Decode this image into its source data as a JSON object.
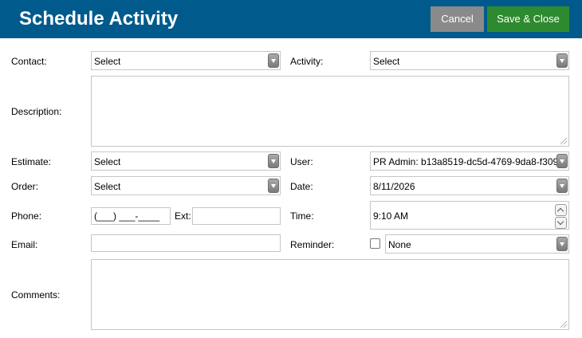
{
  "header": {
    "title": "Schedule Activity",
    "cancel_label": "Cancel",
    "save_label": "Save & Close",
    "bg_color": "#005a8c",
    "save_color": "#2e8a2f",
    "cancel_color": "#8a8a8a"
  },
  "form": {
    "contact": {
      "label": "Contact:",
      "value": "Select"
    },
    "activity": {
      "label": "Activity:",
      "value": "Select"
    },
    "description": {
      "label": "Description:",
      "value": ""
    },
    "estimate": {
      "label": "Estimate:",
      "value": "Select"
    },
    "user": {
      "label": "User:",
      "value": "PR Admin: b13a8519-dc5d-4769-9da8-f309"
    },
    "order": {
      "label": "Order:",
      "value": "Select"
    },
    "date": {
      "label": "Date:",
      "value": "8/11/2026"
    },
    "phone": {
      "label": "Phone:",
      "value": "(___) ___-____"
    },
    "ext": {
      "label": "Ext:",
      "value": ""
    },
    "time": {
      "label": "Time:",
      "value": "9:10 AM"
    },
    "email": {
      "label": "Email:",
      "value": ""
    },
    "reminder": {
      "label": "Reminder:",
      "checked": false,
      "value": "None"
    },
    "comments": {
      "label": "Comments:",
      "value": ""
    }
  }
}
